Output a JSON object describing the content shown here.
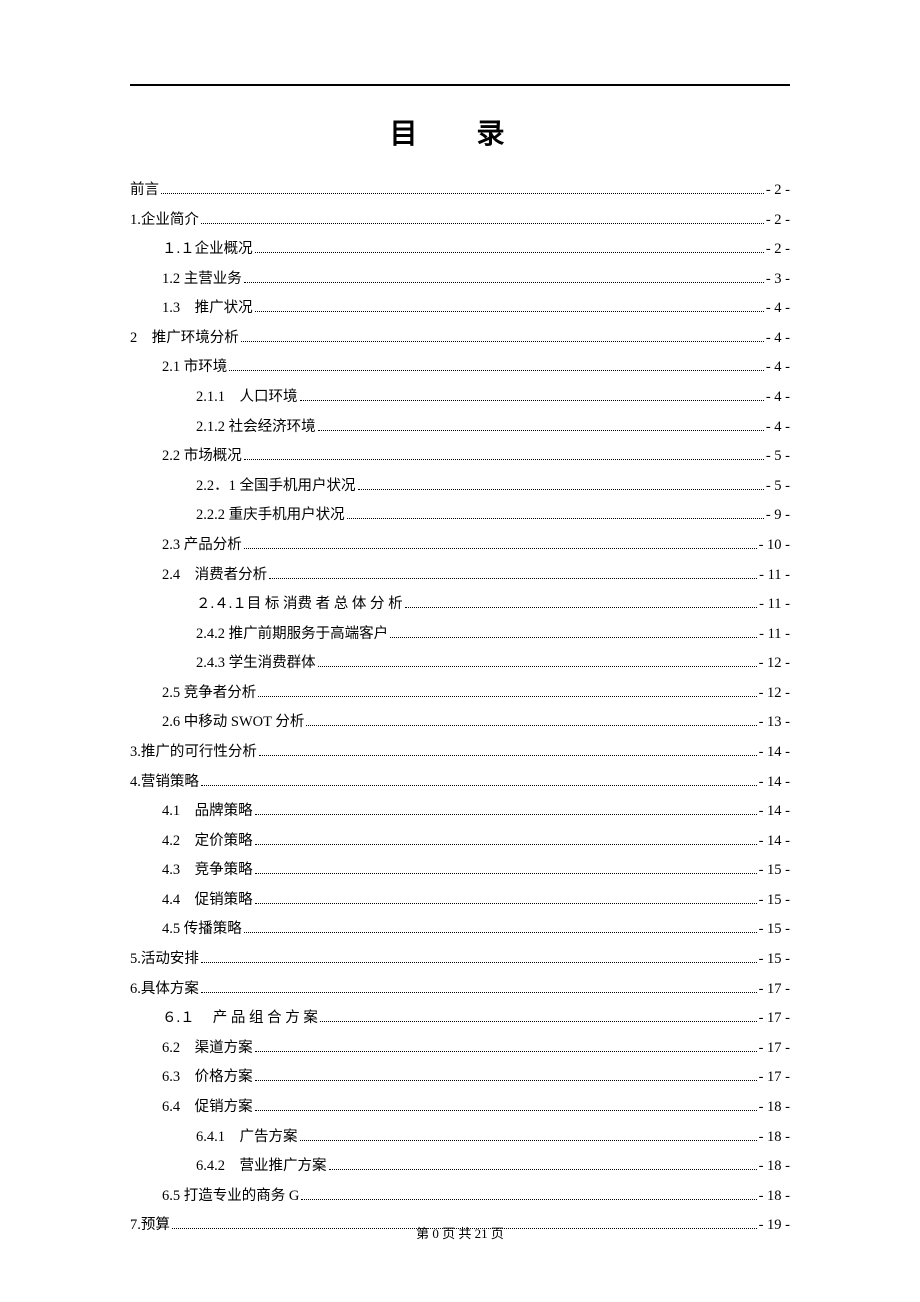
{
  "title": "目 录",
  "footer": "第 0 页 共 21 页",
  "entries": [
    {
      "level": 0,
      "label": "前言",
      "page": "- 2 -"
    },
    {
      "level": 0,
      "label": "1.企业简介",
      "page": "- 2 -"
    },
    {
      "level": 1,
      "label": "１.１企业概况",
      "page": "- 2 -"
    },
    {
      "level": 1,
      "label": "1.2  主营业务",
      "page": "- 3 -"
    },
    {
      "level": 1,
      "label": "1.3　推广状况",
      "page": "- 4 -"
    },
    {
      "level": 0,
      "label": "2　推广环境分析",
      "page": "- 4 -"
    },
    {
      "level": 1,
      "label": "2.1 市环境",
      "page": "- 4 -"
    },
    {
      "level": 2,
      "label": "2.1.1　人口环境",
      "page": "- 4 -"
    },
    {
      "level": 2,
      "label": "2.1.2 社会经济环境",
      "page": "- 4 -"
    },
    {
      "level": 1,
      "label": "2.2 市场概况",
      "page": "- 5 -"
    },
    {
      "level": 2,
      "label": "2.2．1 全国手机用户状况",
      "page": "- 5 -"
    },
    {
      "level": 2,
      "label": "2.2.2 重庆手机用户状况",
      "page": "- 9 -"
    },
    {
      "level": 1,
      "label": "2.3 产品分析",
      "page": "- 10 -"
    },
    {
      "level": 1,
      "label": "2.4　消费者分析",
      "page": "- 11 -"
    },
    {
      "level": 2,
      "label": "２.４.１目 标 消费 者 总 体 分 析",
      "page": "- 11 -"
    },
    {
      "level": 2,
      "label": "2.4.2 推广前期服务于高端客户",
      "page": "- 11 -"
    },
    {
      "level": 2,
      "label": "2.4.3 学生消费群体",
      "page": "- 12 -"
    },
    {
      "level": 1,
      "label": "2.5 竞争者分析",
      "page": "- 12 -"
    },
    {
      "level": 1,
      "label": "2.6  中移动 SWOT 分析",
      "page": "- 13 -"
    },
    {
      "level": 0,
      "label": "3.推广的可行性分析",
      "page": "- 14 -"
    },
    {
      "level": 0,
      "label": "4.营销策略",
      "page": "- 14 -"
    },
    {
      "level": 1,
      "label": "4.1　品牌策略",
      "page": "- 14 -"
    },
    {
      "level": 1,
      "label": "4.2　定价策略",
      "page": "- 14 -"
    },
    {
      "level": 1,
      "label": "4.3　竞争策略",
      "page": "- 15 -"
    },
    {
      "level": 1,
      "label": "4.4　促销策略",
      "page": "- 15 -"
    },
    {
      "level": 1,
      "label": "4.5 传播策略",
      "page": "- 15 -"
    },
    {
      "level": 0,
      "label": "5.活动安排",
      "page": "- 15 -"
    },
    {
      "level": 0,
      "label": "6.具体方案",
      "page": "- 17 -"
    },
    {
      "level": 1,
      "label": "６.１　 产 品 组 合 方 案",
      "page": "- 17 -"
    },
    {
      "level": 1,
      "label": "6.2　渠道方案",
      "page": "- 17 -"
    },
    {
      "level": 1,
      "label": "6.3　价格方案",
      "page": "- 17 -"
    },
    {
      "level": 1,
      "label": "6.4　促销方案",
      "page": "- 18 -"
    },
    {
      "level": 2,
      "label": "6.4.1　广告方案",
      "page": "- 18 -"
    },
    {
      "level": 2,
      "label": "6.4.2　营业推广方案",
      "page": "- 18 -"
    },
    {
      "level": 1,
      "label": "6.5 打造专业的商务 G",
      "page": "- 18 -"
    },
    {
      "level": 0,
      "label": "7.预算",
      "page": "- 19 -"
    }
  ]
}
